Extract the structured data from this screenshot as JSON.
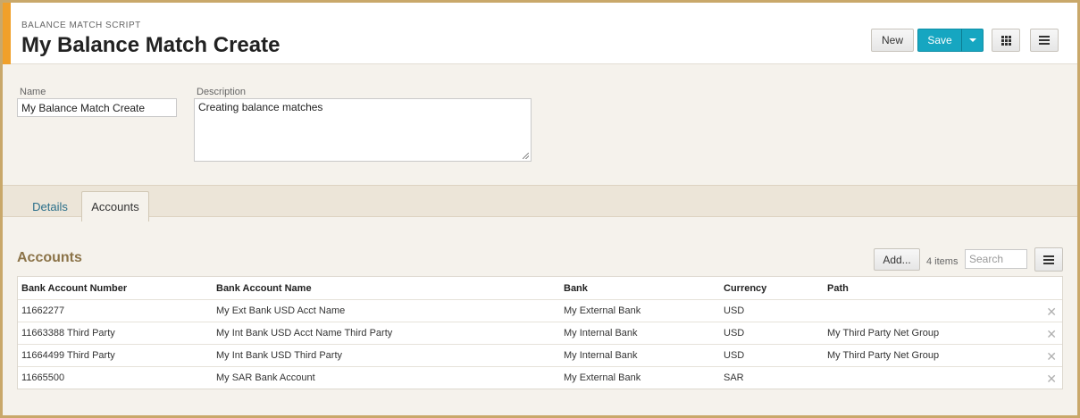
{
  "header": {
    "subtitle": "BALANCE MATCH SCRIPT",
    "title": "My Balance Match Create",
    "new_label": "New",
    "save_label": "Save"
  },
  "form": {
    "name_label": "Name",
    "name_value": "My Balance Match Create",
    "description_label": "Description",
    "description_value": "Creating balance matches"
  },
  "tabs": [
    {
      "label": "Details"
    },
    {
      "label": "Accounts"
    }
  ],
  "accounts": {
    "title": "Accounts",
    "add_label": "Add...",
    "items_count": "4 items",
    "search_placeholder": "Search",
    "columns": [
      "Bank Account Number",
      "Bank Account Name",
      "Bank",
      "Currency",
      "Path"
    ],
    "rows": [
      [
        "11662277",
        "My Ext Bank USD Acct Name",
        "My External Bank",
        "USD",
        ""
      ],
      [
        "11663388 Third Party",
        "My Int Bank USD Acct Name Third Party",
        "My Internal Bank",
        "USD",
        "My Third Party Net Group"
      ],
      [
        "11664499 Third Party",
        "My Int Bank USD Third Party",
        "My Internal Bank",
        "USD",
        "My Third Party Net Group"
      ],
      [
        "11665500",
        "My SAR Bank Account",
        "My External Bank",
        "SAR",
        ""
      ]
    ]
  },
  "colors": {
    "accent": "#f0a02a",
    "save_button": "#16a6c1",
    "section_title": "#8b7348",
    "frame": "#c9a86a"
  }
}
